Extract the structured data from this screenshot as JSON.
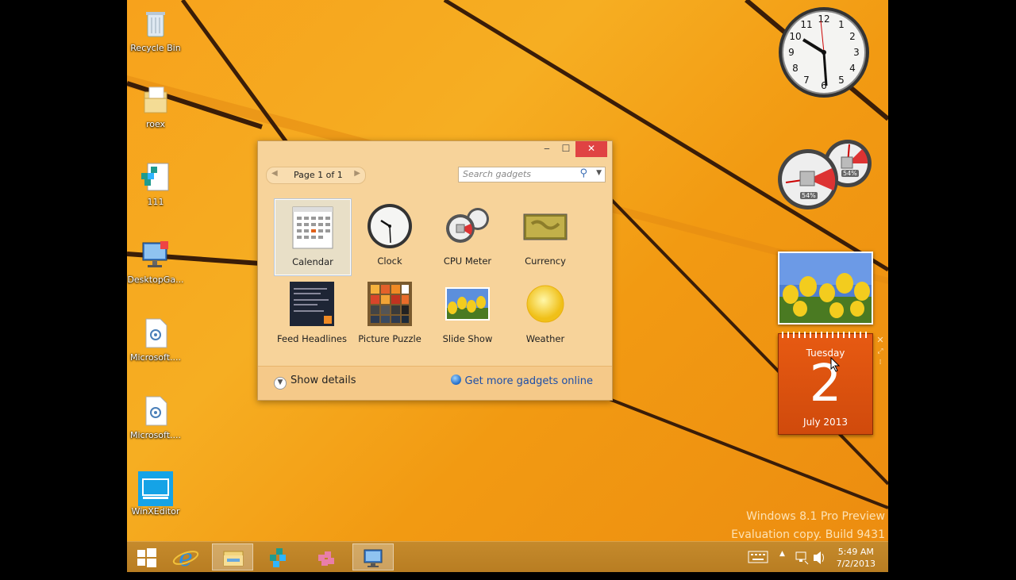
{
  "desktop": {
    "icons": [
      {
        "label": "Recycle Bin",
        "icon": "recycle-bin-icon"
      },
      {
        "label": "roex",
        "icon": "folder-icon"
      },
      {
        "label": "111",
        "icon": "app-icon"
      },
      {
        "label": "DesktopGa...",
        "icon": "computer-icon"
      },
      {
        "label": "Microsoft....",
        "icon": "document-icon"
      },
      {
        "label": "Microsoft....",
        "icon": "document-icon"
      },
      {
        "label": "WinXEditor",
        "icon": "winxeditor-icon"
      }
    ]
  },
  "gallery": {
    "pager_text": "Page 1 of 1",
    "search_placeholder": "Search gadgets",
    "gadgets": [
      {
        "label": "Calendar",
        "selected": true
      },
      {
        "label": "Clock"
      },
      {
        "label": "CPU Meter"
      },
      {
        "label": "Currency"
      },
      {
        "label": "Feed Headlines"
      },
      {
        "label": "Picture Puzzle"
      },
      {
        "label": "Slide Show"
      },
      {
        "label": "Weather"
      }
    ],
    "show_details": "Show details",
    "get_more": "Get more gadgets online"
  },
  "side_gadgets": {
    "cpu_percent": "54%",
    "memory_percent": "54%",
    "calendar": {
      "day_name": "Tuesday",
      "day": "2",
      "month": "July 2013"
    }
  },
  "watermark": {
    "line1": "Windows 8.1 Pro Preview",
    "line2": "Evaluation copy. Build 9431"
  },
  "taskbar": {
    "time": "5:49 AM",
    "date": "7/2/2013"
  },
  "colors": {
    "accent": "#f6a21c",
    "close_red": "#e04343",
    "calendar_orange": "#e75a12"
  }
}
